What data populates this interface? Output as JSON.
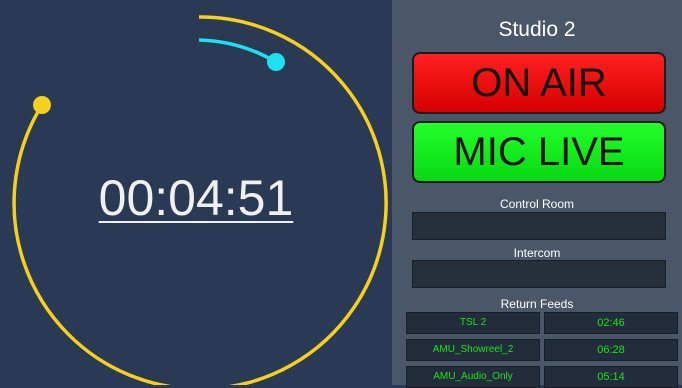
{
  "timer": {
    "display": "00:04:51"
  },
  "studio": {
    "name": "Studio 2"
  },
  "tally": {
    "on_air": "ON AIR",
    "mic_live": "MIC LIVE"
  },
  "sections": {
    "control_room": "Control Room",
    "intercom": "Intercom",
    "return_feeds": "Return Feeds"
  },
  "return_feeds": [
    {
      "name": "TSL 2",
      "time": "02:46"
    },
    {
      "name": "AMU_Showreel_2",
      "time": "06:28"
    },
    {
      "name": "AMU_Audio_Only",
      "time": "05:14"
    }
  ],
  "colors": {
    "ring": "#f5d01e",
    "progress": "#1ee0f0",
    "on_air": "#ff1a1a",
    "mic_live": "#14f01e",
    "feed_text": "#19e619"
  }
}
